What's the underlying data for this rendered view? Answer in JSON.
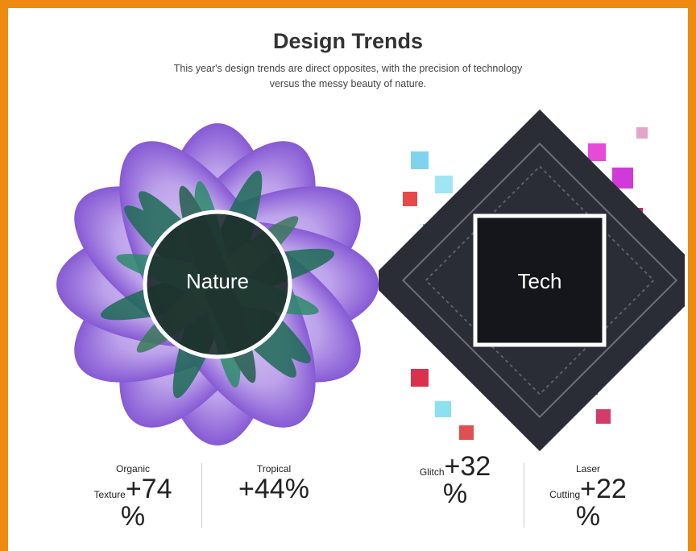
{
  "header": {
    "title": "Design Trends",
    "subtitle_line1": "This year's design trends are direct opposites, with the precision of technology",
    "subtitle_line2": "versus the messy beauty of nature."
  },
  "nature": {
    "label": "Nature",
    "stats": [
      {
        "label_top": "Organic",
        "label_inline": "Texture",
        "value": "+74",
        "unit": "%"
      },
      {
        "label_top": "Tropical",
        "value": "+44%"
      }
    ]
  },
  "tech": {
    "label": "Tech",
    "stats": [
      {
        "label_inline": "Glitch",
        "value": "+32",
        "unit": "%"
      },
      {
        "label_top": "Laser",
        "label_inline": "Cutting",
        "value": "+22",
        "unit": "%"
      }
    ]
  },
  "colors": {
    "page_border": "#ee8a10",
    "purple": "#8a5fd6",
    "leaf_green": "#1f6a55",
    "dark": "#1c1c22"
  }
}
